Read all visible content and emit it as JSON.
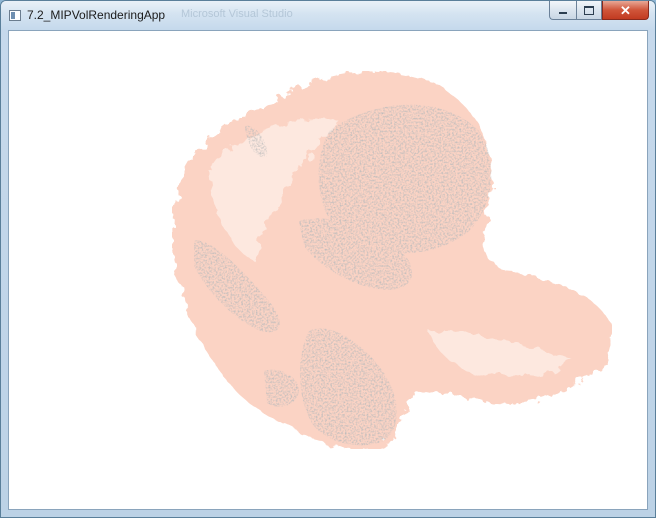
{
  "window": {
    "title": "7.2_MIPVolRenderingApp",
    "background_title": "Microsoft Visual Studio",
    "controls": {
      "minimize_glyph": "–",
      "maximize_glyph": "□",
      "close_glyph": "✕"
    }
  },
  "viewport": {
    "background": "#ffffff",
    "colors": {
      "soft_tissue": "#fbd3c4",
      "soft_tissue_light": "#fde8df",
      "bone": "#808080",
      "bone_dark": "#6a6a6a"
    }
  },
  "icons": {
    "app": "app-window-icon",
    "minimize": "minimize-icon",
    "maximize": "maximize-icon",
    "close": "close-icon"
  }
}
